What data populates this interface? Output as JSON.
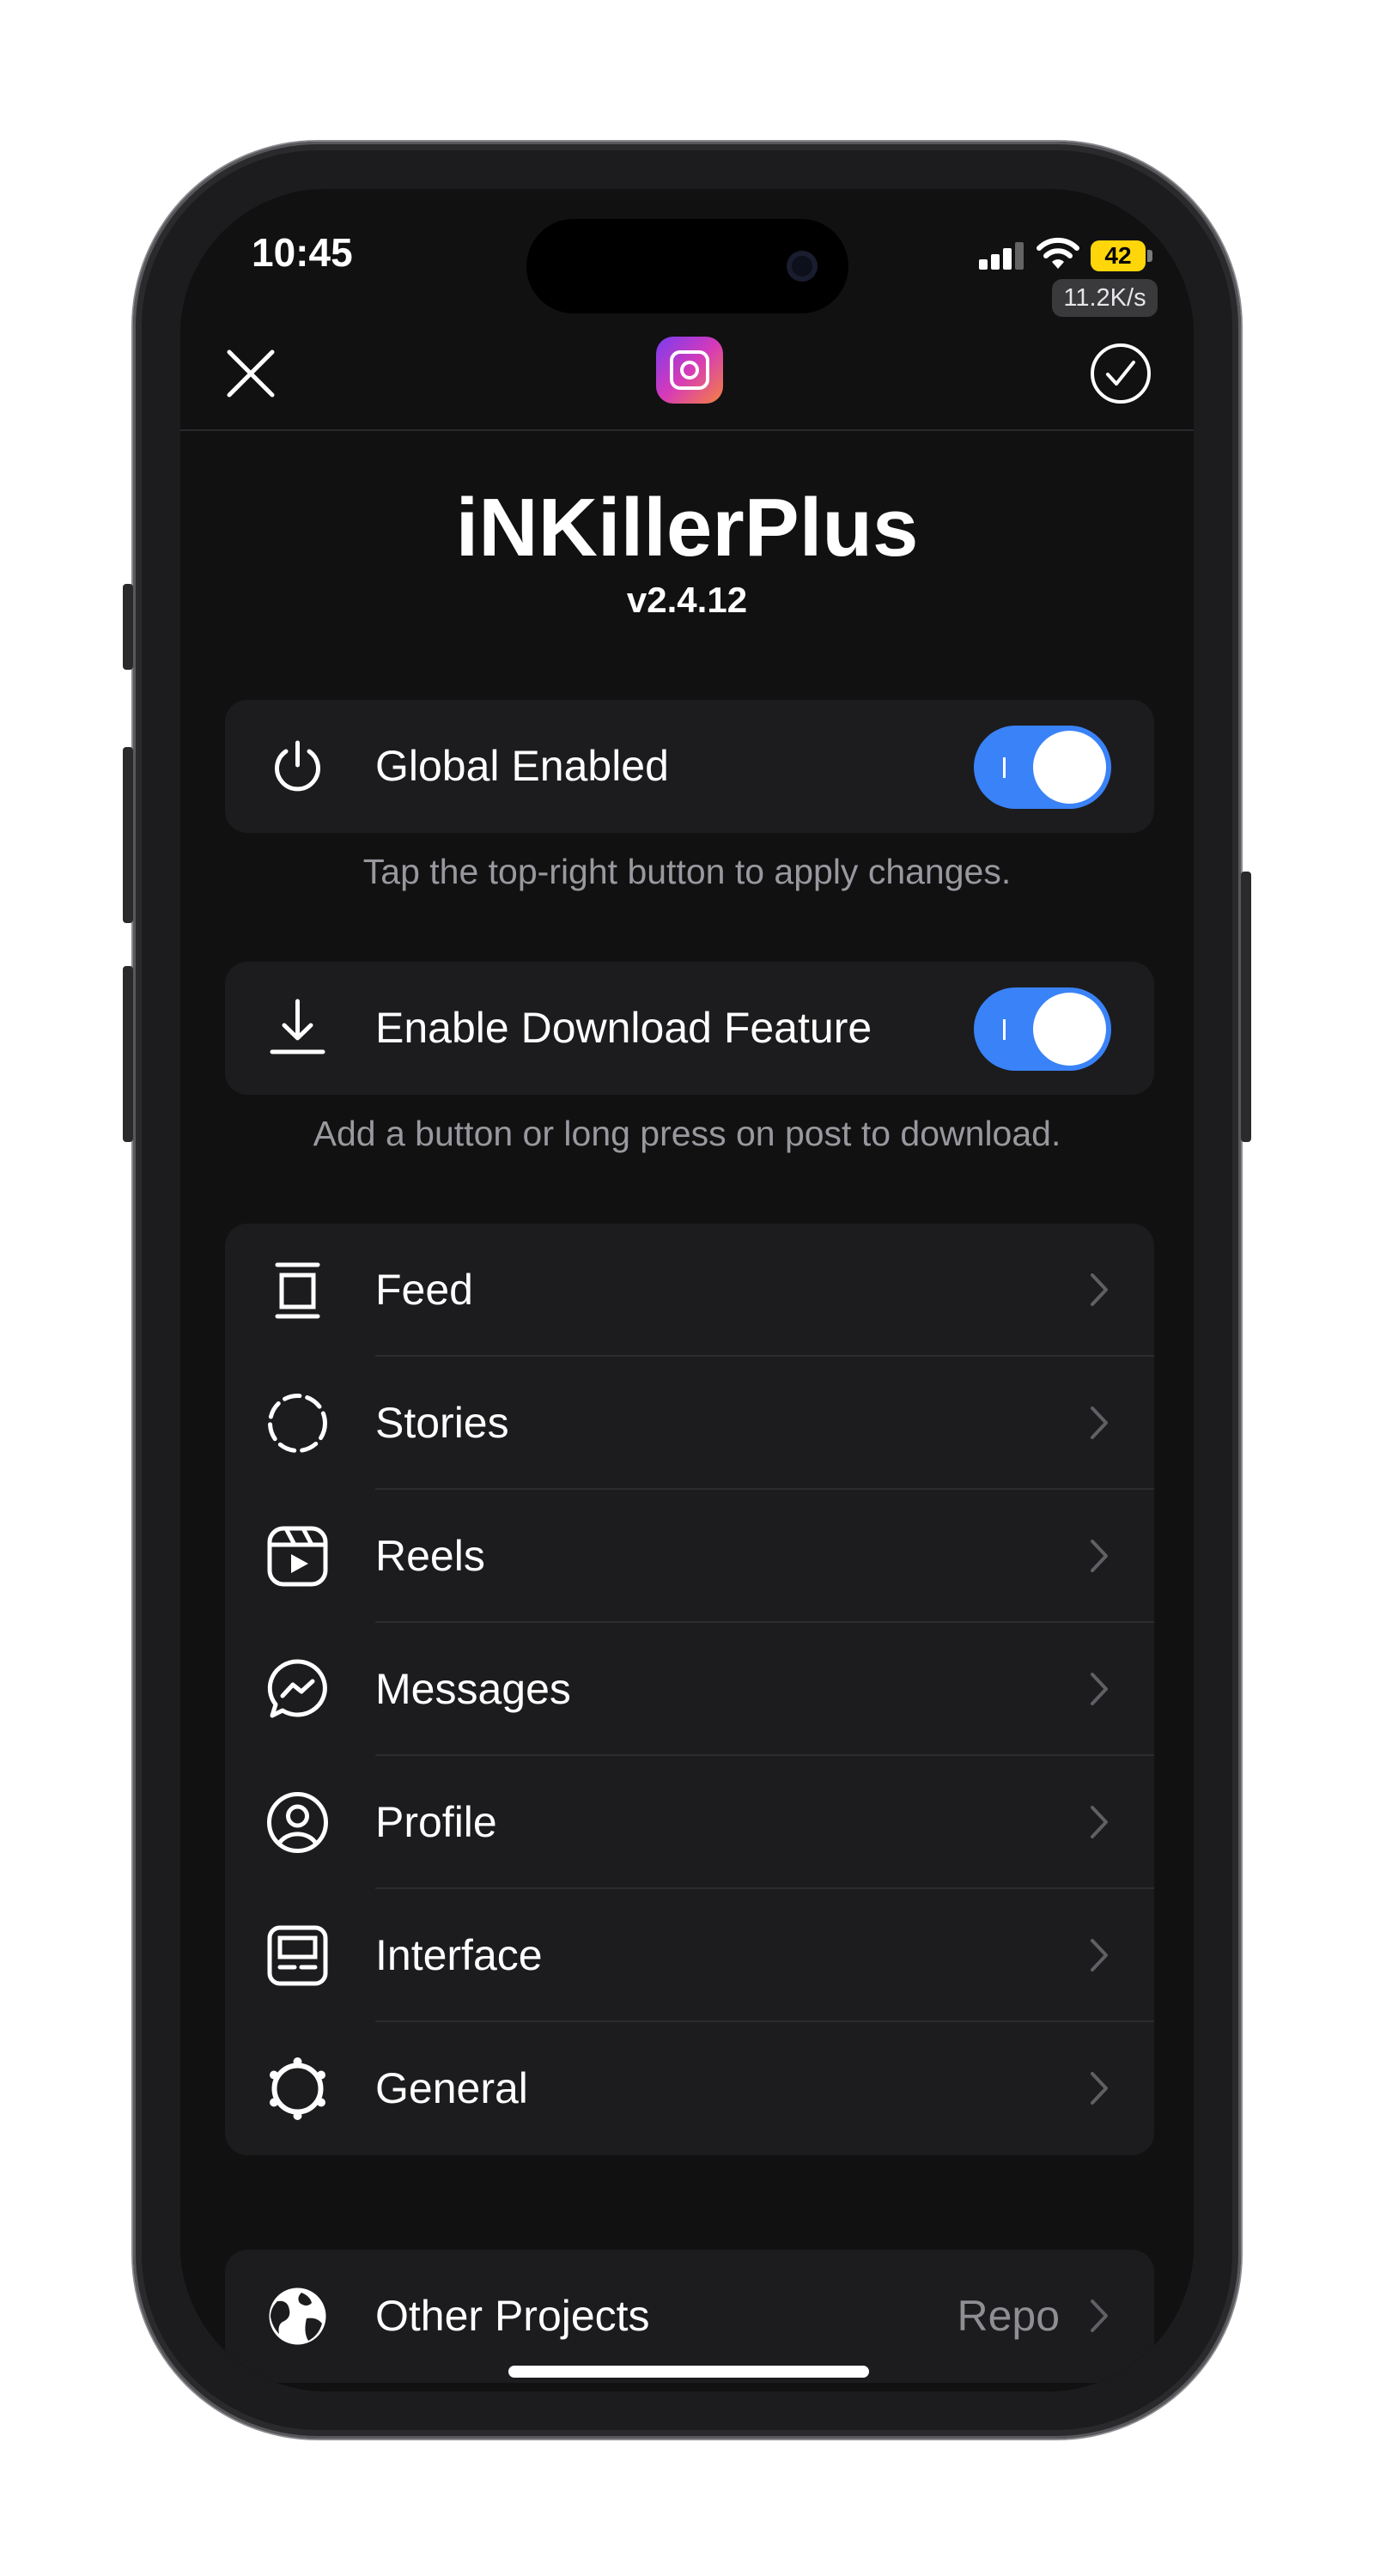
{
  "status_bar": {
    "time": "10:45",
    "battery": "42",
    "net_speed": "11.2K/s"
  },
  "header": {
    "close_icon": "close-icon",
    "confirm_icon": "checkmark-circle-icon",
    "app_icon": "app-icon"
  },
  "title": "iNKillerPlus",
  "version": "v2.4.12",
  "global": {
    "label": "Global Enabled",
    "enabled": true,
    "icon": "power-icon",
    "footnote": "Tap the top-right button to apply changes."
  },
  "download": {
    "label": "Enable Download Feature",
    "enabled": true,
    "icon": "download-icon",
    "footnote": "Add a button or long press on post to download."
  },
  "menu": [
    {
      "label": "Feed",
      "icon": "feed-icon"
    },
    {
      "label": "Stories",
      "icon": "stories-icon"
    },
    {
      "label": "Reels",
      "icon": "reels-icon"
    },
    {
      "label": "Messages",
      "icon": "messenger-icon"
    },
    {
      "label": "Profile",
      "icon": "profile-icon"
    },
    {
      "label": "Interface",
      "icon": "interface-icon"
    },
    {
      "label": "General",
      "icon": "gear-icon"
    }
  ],
  "other": {
    "label": "Other Projects",
    "detail": "Repo",
    "icon": "globe-icon"
  },
  "colors": {
    "toggle_on": "#3a82f7",
    "card": "#1c1c1e",
    "background": "#111112",
    "battery": "#ffd60a"
  }
}
